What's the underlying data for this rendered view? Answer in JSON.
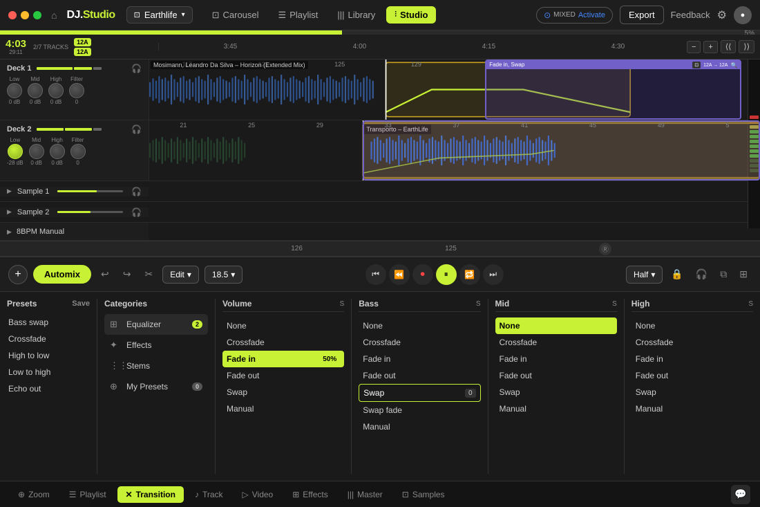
{
  "titlebar": {
    "logo": "DJ.Studio",
    "logo_prefix": "DJ.",
    "logo_suffix": "Studio",
    "project": "Earthlife",
    "nav": [
      {
        "label": "Carousel",
        "icon": "⊡",
        "active": false
      },
      {
        "label": "Playlist",
        "icon": "☰",
        "active": false
      },
      {
        "label": "Library",
        "icon": "|||",
        "active": false
      },
      {
        "label": "Studio",
        "icon": "⫶",
        "active": true
      }
    ],
    "mixed": "MIXED",
    "activate": "Activate",
    "export": "Export",
    "feedback": "Feedback"
  },
  "timeline": {
    "markers": [
      "3:45",
      "4:00",
      "4:15",
      "4:30"
    ],
    "bottom_markers": [
      "126",
      "125"
    ],
    "percent": "5%"
  },
  "transport": {
    "time": "4:03",
    "sub_time": "29:11",
    "tracks": "2/7",
    "tracks_label": "TRACKS",
    "key1": "12A",
    "key2": "12A",
    "tempo": "18.5",
    "half": "Half"
  },
  "decks": [
    {
      "label": "Deck 1",
      "track": "Mosimann, Leandro Da Silva – Horizon (Extended Mix)",
      "eq": [
        {
          "label": "Low",
          "value": "0 dB"
        },
        {
          "label": "Mid",
          "value": "0 dB"
        },
        {
          "label": "High",
          "value": "0 dB"
        },
        {
          "label": "Filter",
          "value": "0"
        }
      ]
    },
    {
      "label": "Deck 2",
      "track": "Transporto – EarthLife",
      "eq": [
        {
          "label": "Low",
          "value": "-28 dB"
        },
        {
          "label": "Mid",
          "value": "0 dB"
        },
        {
          "label": "High",
          "value": "0 dB"
        },
        {
          "label": "Filter",
          "value": "0"
        }
      ]
    }
  ],
  "samples": [
    {
      "label": "Sample 1"
    },
    {
      "label": "Sample 2"
    }
  ],
  "bpm_manual": "8BPM Manual",
  "transition_label": "Fade in, Swap",
  "transition_key": "12A → 12A",
  "automix_toolbar": {
    "automix": "Automix",
    "edit": "Edit",
    "tempo": "18.5"
  },
  "bottom_panel": {
    "presets": {
      "header": "Presets",
      "save": "Save",
      "items": [
        "Bass swap",
        "Crossfade",
        "High to low",
        "Low to high",
        "Echo out"
      ]
    },
    "categories": {
      "header": "Categories",
      "items": [
        {
          "label": "Equalizer",
          "icon": "⊞",
          "badge": "2"
        },
        {
          "label": "Effects",
          "icon": "✦",
          "badge": null
        },
        {
          "label": "Stems",
          "icon": "⋮⋮",
          "badge": null
        },
        {
          "label": "My Presets",
          "icon": "⊕",
          "badge": "0"
        }
      ]
    },
    "volume": {
      "header": "Volume",
      "s_label": "S",
      "options": [
        {
          "label": "None",
          "state": "normal"
        },
        {
          "label": "Crossfade",
          "state": "normal"
        },
        {
          "label": "Fade in",
          "state": "selected",
          "value": "50%"
        },
        {
          "label": "Fade out",
          "state": "normal"
        },
        {
          "label": "Swap",
          "state": "normal"
        },
        {
          "label": "Manual",
          "state": "normal"
        }
      ]
    },
    "bass": {
      "header": "Bass",
      "s_label": "S",
      "options": [
        {
          "label": "None",
          "state": "normal"
        },
        {
          "label": "Crossfade",
          "state": "normal"
        },
        {
          "label": "Fade in",
          "state": "normal"
        },
        {
          "label": "Fade out",
          "state": "normal"
        },
        {
          "label": "Swap",
          "state": "selected-outline",
          "value": "0"
        },
        {
          "label": "Swap fade",
          "state": "normal"
        },
        {
          "label": "Manual",
          "state": "normal"
        }
      ]
    },
    "mid": {
      "header": "Mid",
      "s_label": "S",
      "options": [
        {
          "label": "None",
          "state": "selected"
        },
        {
          "label": "Crossfade",
          "state": "normal"
        },
        {
          "label": "Fade in",
          "state": "normal"
        },
        {
          "label": "Fade out",
          "state": "normal"
        },
        {
          "label": "Swap",
          "state": "normal"
        },
        {
          "label": "Manual",
          "state": "normal"
        }
      ]
    },
    "high": {
      "header": "High",
      "s_label": "S",
      "options": [
        {
          "label": "None",
          "state": "normal"
        },
        {
          "label": "Crossfade",
          "state": "normal"
        },
        {
          "label": "Fade in",
          "state": "normal"
        },
        {
          "label": "Fade out",
          "state": "normal"
        },
        {
          "label": "Swap",
          "state": "normal"
        },
        {
          "label": "Manual",
          "state": "normal"
        }
      ]
    }
  },
  "bottom_tabs": [
    {
      "label": "Zoom",
      "icon": "⊕",
      "active": false
    },
    {
      "label": "Playlist",
      "icon": "☰",
      "active": false
    },
    {
      "label": "Transition",
      "icon": "✕",
      "active": true,
      "style": "yellow"
    },
    {
      "label": "Track",
      "icon": "♪",
      "active": false
    },
    {
      "label": "Video",
      "icon": "▷",
      "active": false
    },
    {
      "label": "Effects",
      "icon": "⊞",
      "active": false
    },
    {
      "label": "Master",
      "icon": "|||",
      "active": false
    },
    {
      "label": "Samples",
      "icon": "⊡",
      "active": false
    }
  ]
}
